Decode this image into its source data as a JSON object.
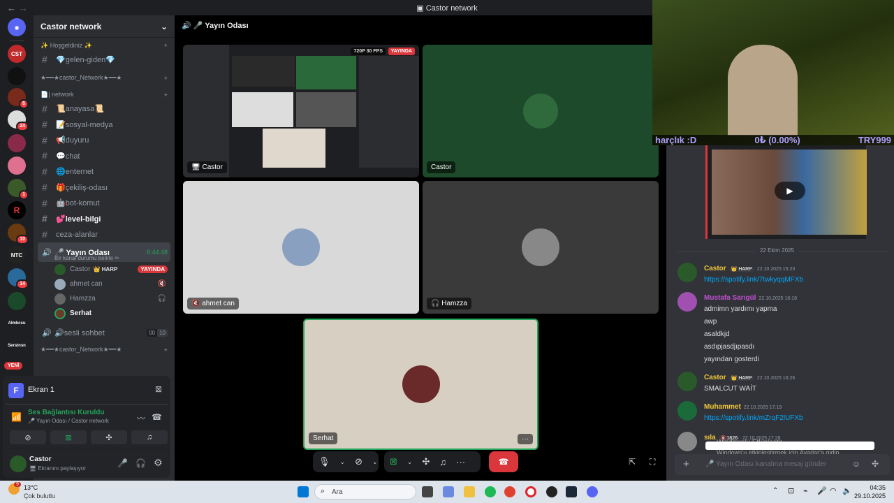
{
  "titlebar": {
    "title": "Castor network",
    "back": "←",
    "forward": "→"
  },
  "rail": {
    "badges": [
      "5",
      "24",
      "1",
      "10",
      "14",
      "11"
    ],
    "new_label": "YENİ"
  },
  "server": {
    "name": "Castor network",
    "categories": [
      {
        "label": "✨ Hoşgeldiniz ✨"
      },
      {
        "label": "★━━★castor_Network★━━★"
      },
      {
        "label": "📄| network"
      },
      {
        "label": "★━━★castor_Network★━━★"
      }
    ],
    "welcome_channel": "💎gelen-giden💎",
    "channels": [
      {
        "name": "📜anayasa📜",
        "bold": false
      },
      {
        "name": "📝sosyal-medya",
        "bold": false
      },
      {
        "name": "📢duyuru",
        "bold": false
      },
      {
        "name": "💬chat",
        "bold": false
      },
      {
        "name": "🌐enternet",
        "bold": false
      },
      {
        "name": "🎁çekiliş-odası",
        "bold": false
      },
      {
        "name": "🤖bot-komut",
        "bold": false
      },
      {
        "name": "💕level-bilgi",
        "bold": true
      },
      {
        "name": "ceza-alanlar",
        "bold": false
      }
    ],
    "voice_channel": {
      "name": "🎤 Yayın Odası",
      "timer": "6:44:48",
      "status_hint": "Bir kanal durumu belirle ✏",
      "users": [
        {
          "name": "Castor",
          "tag": "👑 HARP",
          "live": "YAYINDA"
        },
        {
          "name": "ahmet can",
          "tag": "",
          "live": ""
        },
        {
          "name": "Hamzza",
          "tag": "",
          "live": ""
        },
        {
          "name": "Serhat",
          "tag": "",
          "live": ""
        }
      ]
    },
    "other_voice": {
      "name": "🔊sesli sohbet",
      "count_a": "00",
      "count_b": "10"
    }
  },
  "panel": {
    "screen_title": "Ekran 1",
    "connection_status": "Ses Bağlantısı Kuruldu",
    "connection_sub": "🎤 Yayın Odası / Castor network",
    "user_name": "Castor",
    "user_status": "🖥 Ekranını paylaşıyor"
  },
  "main": {
    "header": "🎤 Yayın Odası",
    "stream_badge": "720P 30 FPS",
    "live_badge": "YAYINDA",
    "tiles": [
      {
        "name": "🖥 Castor"
      },
      {
        "name": "Castor"
      },
      {
        "name": "🔇 ahmet can"
      },
      {
        "name": "🎧 Hamzza"
      },
      {
        "name": "Serhat"
      }
    ]
  },
  "cam_overlay": {
    "left": "harçlık :D",
    "mid": "0₺ (0.00%)",
    "right": "TRY999"
  },
  "chat": {
    "date_divider": "22 Ekim 2025",
    "messages": [
      {
        "author": "Castor",
        "color": "#f0c63b",
        "role": "👑 HARP",
        "time": "22.10.2025 15:23",
        "lines": [
          "https://spotify.link/7twkyqqMFXb"
        ],
        "link": true
      },
      {
        "author": "Mustafa Sarıgül",
        "color": "#c050d0",
        "role": "",
        "time": "22.10.2025 16:18",
        "lines": [
          "admimn yardımı yapma",
          "awp",
          "asaldkjd",
          "asdıpjasdjıpasdı",
          "yayından gosterdi"
        ],
        "link": false
      },
      {
        "author": "Castor",
        "color": "#f0c63b",
        "role": "👑 HARP",
        "time": "22.10.2025 16:26",
        "lines": [
          "SMALCUT WAİT"
        ],
        "link": false
      },
      {
        "author": "Muhammet",
        "color": "#f0c63b",
        "role": "",
        "time": "22.10.2025 17:19",
        "lines": [
          "https://spotify.link/mZrqF2lUFXb"
        ],
        "link": true
      },
      {
        "author": "sıla",
        "color": "#f0c63b",
        "role": "🔇1826",
        "time": "22.10.2025 17:28",
        "lines": [],
        "link": false
      }
    ],
    "input_placeholder": "🎤 Yayın Odası kanalına mesaj gönder",
    "activation_title": "Windows'u Etkinleştir",
    "activation_sub": "Windows'u etkinleştirmek için Ayarlar'a gidin."
  },
  "taskbar": {
    "weather_temp": "13°C",
    "weather_desc": "Çok bulutlu",
    "search_placeholder": "Ara",
    "time": "04:35",
    "date": "29.10.2025",
    "notif": "9"
  },
  "colors": {
    "accent_green": "#23a55a",
    "live_red": "#da373c",
    "link": "#00a8fc"
  }
}
